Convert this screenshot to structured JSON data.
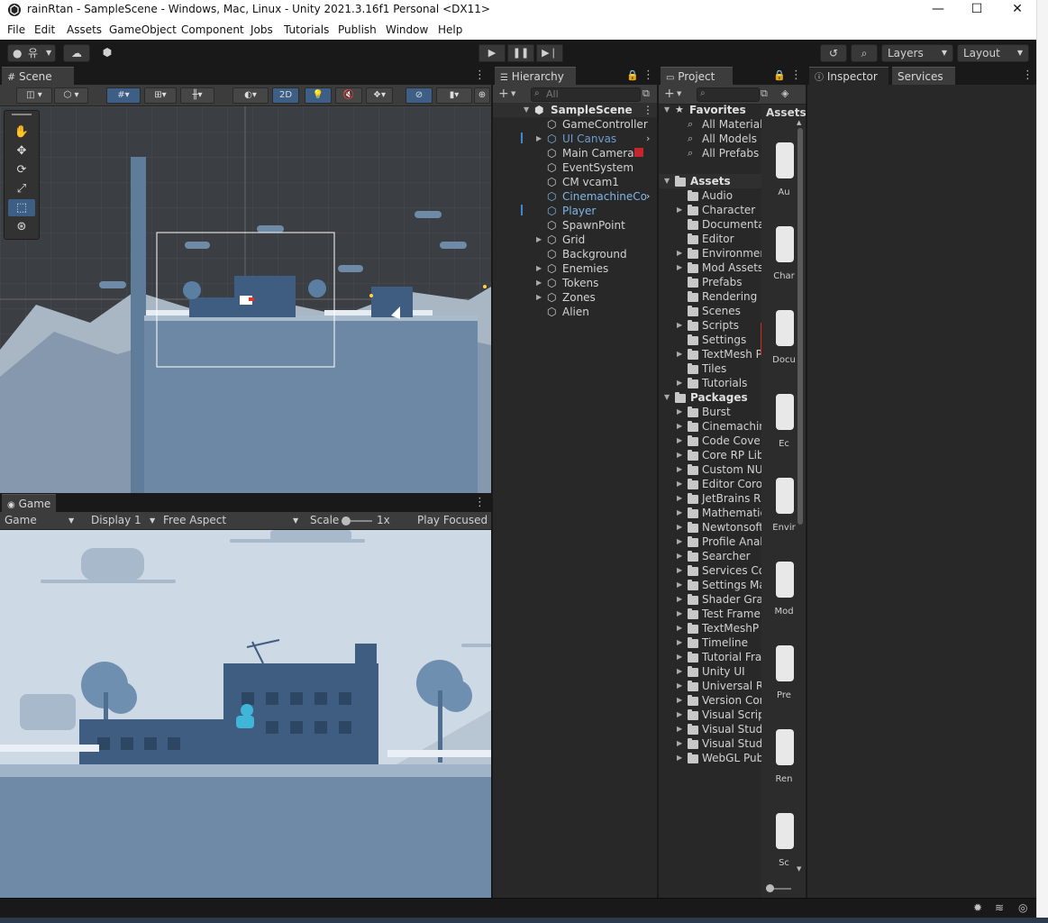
{
  "window": {
    "title": "rainRtan - SampleScene - Windows, Mac, Linux - Unity 2021.3.16f1 Personal <DX11>",
    "minimize": "—",
    "maximize": "☐",
    "close": "✕"
  },
  "menu": [
    "File",
    "Edit",
    "Assets",
    "GameObject",
    "Component",
    "Jobs",
    "Tutorials",
    "Publish",
    "Window",
    "Help"
  ],
  "toolbar": {
    "account_label": "유",
    "layers_label": "Layers",
    "layout_label": "Layout"
  },
  "scene": {
    "tab": "Scene",
    "mode_2d": "2D"
  },
  "game": {
    "tab": "Game",
    "mode": "Game",
    "display": "Display 1",
    "aspect": "Free Aspect",
    "scale_label": "Scale",
    "scale_value": "1x",
    "play_focused": "Play Focused"
  },
  "hierarchy": {
    "tab": "Hierarchy",
    "search_placeholder": "All",
    "scene_name": "SampleScene",
    "items": [
      {
        "label": "GameController",
        "style": "normal",
        "expandable": false
      },
      {
        "label": "UI Canvas",
        "style": "dimblue",
        "expandable": true
      },
      {
        "label": "Main Camera",
        "style": "normal",
        "expandable": false
      },
      {
        "label": "EventSystem",
        "style": "normal",
        "expandable": false
      },
      {
        "label": "CM vcam1",
        "style": "normal",
        "expandable": false
      },
      {
        "label": "CinemachineCo",
        "style": "blue",
        "expandable": false
      },
      {
        "label": "Player",
        "style": "blue",
        "expandable": false
      },
      {
        "label": "SpawnPoint",
        "style": "normal",
        "expandable": false
      },
      {
        "label": "Grid",
        "style": "normal",
        "expandable": true
      },
      {
        "label": "Background",
        "style": "normal",
        "expandable": false
      },
      {
        "label": "Enemies",
        "style": "normal",
        "expandable": true
      },
      {
        "label": "Tokens",
        "style": "normal",
        "expandable": true
      },
      {
        "label": "Zones",
        "style": "normal",
        "expandable": true
      },
      {
        "label": "Alien",
        "style": "normal",
        "expandable": false
      }
    ]
  },
  "project": {
    "tab": "Project",
    "favorites_label": "Favorites",
    "favorites": [
      "All Material",
      "All Models",
      "All Prefabs"
    ],
    "assets_label": "Assets",
    "assets": [
      {
        "label": "Audio",
        "expandable": false
      },
      {
        "label": "Character",
        "expandable": true
      },
      {
        "label": "Documenta",
        "expandable": false
      },
      {
        "label": "Editor",
        "expandable": false
      },
      {
        "label": "Environmen",
        "expandable": true
      },
      {
        "label": "Mod Assets",
        "expandable": true
      },
      {
        "label": "Prefabs",
        "expandable": false
      },
      {
        "label": "Rendering",
        "expandable": false
      },
      {
        "label": "Scenes",
        "expandable": false
      },
      {
        "label": "Scripts",
        "expandable": true
      },
      {
        "label": "Settings",
        "expandable": false
      },
      {
        "label": "TextMesh P",
        "expandable": true
      },
      {
        "label": "Tiles",
        "expandable": false
      },
      {
        "label": "Tutorials",
        "expandable": true
      }
    ],
    "packages_label": "Packages",
    "packages": [
      "Burst",
      "Cinemachin",
      "Code Cove",
      "Core RP Lib",
      "Custom NU",
      "Editor Coro",
      "JetBrains R",
      "Mathematic",
      "Newtonsoft",
      "Profile Anal",
      "Searcher",
      "Services Co",
      "Settings Ma",
      "Shader Gra",
      "Test Frame",
      "TextMeshP",
      "Timeline",
      "Tutorial Fra",
      "Unity UI",
      "Universal R",
      "Version Cor",
      "Visual Scrip",
      "Visual Stud",
      "Visual Stud",
      "WebGL Pub"
    ],
    "grid_header": "Assets",
    "grid_items": [
      "Au",
      "Char",
      "Docu",
      "Ec",
      "Envir",
      "Mod",
      "Pre",
      "Ren",
      "Sc"
    ]
  },
  "inspector": {
    "tab": "Inspector",
    "services_tab": "Services"
  },
  "colors": {
    "accent_blue": "#3d6fa8",
    "selection_blue": "#2c5d87",
    "game_sky": "#c9d6e2",
    "building": "#4a6a8e"
  }
}
